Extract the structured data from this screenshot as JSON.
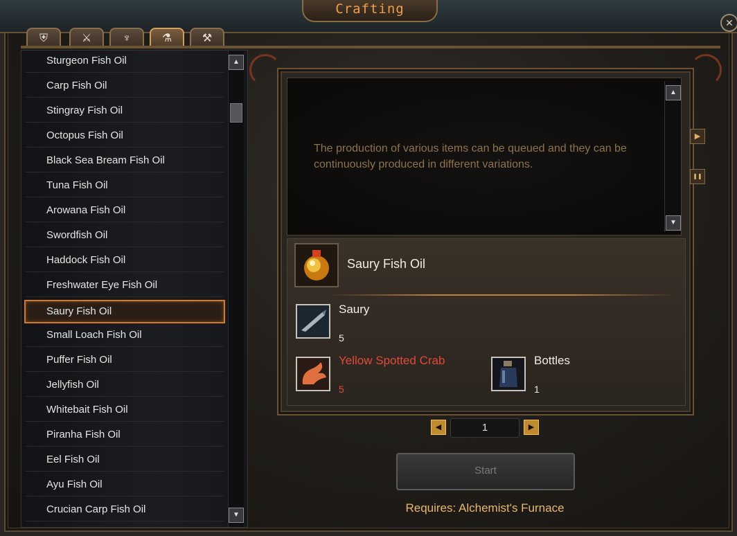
{
  "window": {
    "title": "Crafting",
    "close_label": "✕"
  },
  "tabs": [
    {
      "icon": "armor-icon",
      "glyph": "⛨"
    },
    {
      "icon": "sword-icon",
      "glyph": "⚔"
    },
    {
      "icon": "fishing-icon",
      "glyph": "♆"
    },
    {
      "icon": "potion-icon",
      "glyph": "⚗"
    },
    {
      "icon": "pickaxe-icon",
      "glyph": "⚒"
    }
  ],
  "recipe_list": {
    "items": [
      "Sturgeon Fish Oil",
      "Carp Fish Oil",
      "Stingray Fish Oil",
      "Octopus Fish Oil",
      "Black Sea Bream Fish Oil",
      "Tuna Fish Oil",
      "Arowana Fish Oil",
      "Swordfish Oil",
      "Haddock Fish Oil",
      "Freshwater Eye Fish Oil",
      "Saury Fish Oil",
      "Small Loach Fish Oil",
      "Puffer Fish Oil",
      "Jellyfish Oil",
      "Whitebait Fish Oil",
      "Piranha Fish Oil",
      "Eel Fish Oil",
      "Ayu Fish Oil",
      "Crucian Carp Fish Oil"
    ],
    "selected": "Saury Fish Oil"
  },
  "description": "The production of various items can be queued and they can be continuously produced in different variations.",
  "recipe": {
    "result_name": "Saury Fish Oil",
    "ingredients": [
      {
        "name": "Saury",
        "qty": "5",
        "enough": true,
        "icon": "fish-icon"
      },
      {
        "name": "Yellow Spotted Crab",
        "qty": "5",
        "enough": false,
        "icon": "crab-claw-icon"
      },
      {
        "name": "Bottles",
        "qty": "1",
        "enough": true,
        "icon": "bottle-icon"
      }
    ]
  },
  "quantity": {
    "value": "1",
    "decrease_label": "◀",
    "increase_label": "▶"
  },
  "start_label": "Start",
  "requires_text": "Requires: Alchemist's Furnace",
  "side_controls": {
    "play_label": "▶",
    "pause_label": "❚❚"
  },
  "scroll": {
    "up_label": "▲",
    "down_label": "▼"
  },
  "colors": {
    "accent": "#f0a04a",
    "selection_border": "#d27a26",
    "description_text": "#8e7350",
    "missing_ingredient": "#e04a3a",
    "requires_text": "#e8b870"
  }
}
